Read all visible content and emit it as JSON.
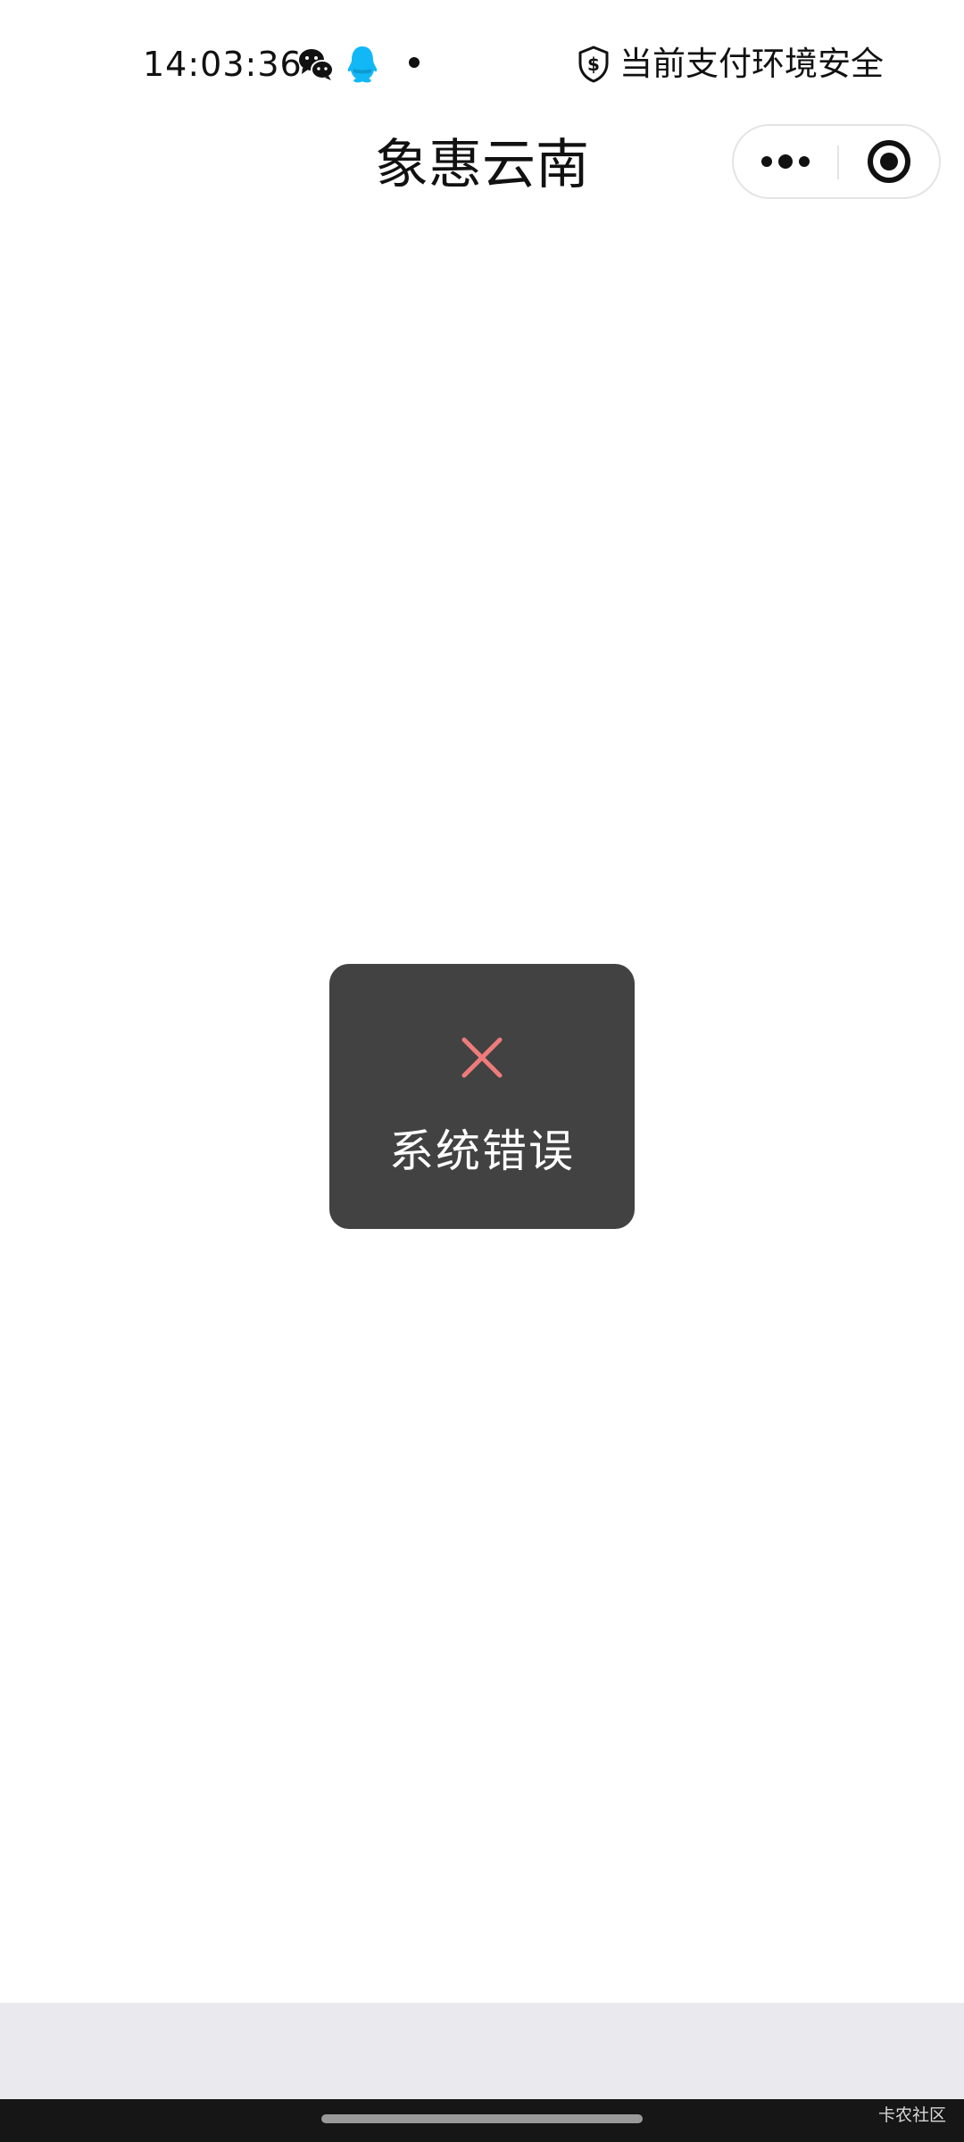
{
  "status_bar": {
    "time": "14:03:36",
    "icons": [
      "wechat-icon",
      "qq-icon",
      "dot-icon"
    ],
    "security_text": "当前支付环境安全"
  },
  "navigation": {
    "title": "象惠云南",
    "capsule": {
      "more_icon": "more-dots-icon",
      "close_icon": "target-circle-icon"
    }
  },
  "toast": {
    "icon": "error-cross-icon",
    "icon_color": "#f07b7b",
    "message": "系统错误"
  },
  "system_nav": {
    "watermark": "卡农社区"
  },
  "colors": {
    "toast_background": "#424242",
    "bottom_area": "#e9e9ee",
    "nav_bar": "#161616"
  }
}
